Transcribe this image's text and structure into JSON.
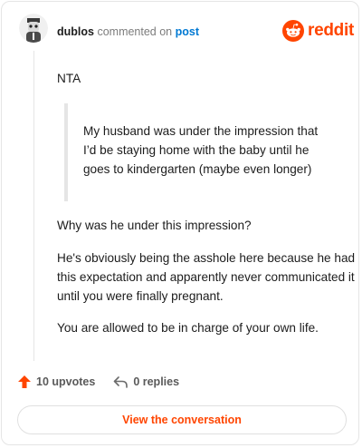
{
  "header": {
    "username": "dublos",
    "action": "commented on",
    "post_link": "post",
    "brand": "reddit"
  },
  "comment": {
    "intro": "NTA",
    "quote": "My husband was under the impression that I’d be staying home with the baby until he goes to kindergarten (maybe even longer)",
    "paragraphs": [
      "Why was he under this impression?",
      "He's obviously being the asshole here because he had this expectation and apparently never communicated it until you were finally pregnant.",
      "You are allowed to be in charge of your own life."
    ]
  },
  "footer": {
    "upvotes": "10 upvotes",
    "replies": "0 replies",
    "view_button": "View the conversation"
  },
  "colors": {
    "brand": "#ff4500",
    "link": "#0079d3"
  }
}
